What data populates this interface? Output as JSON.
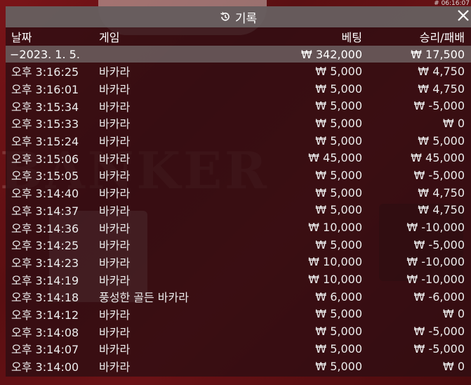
{
  "corner_time": "# 06:16:07",
  "header": {
    "title": "기록",
    "icon": "history-icon",
    "close_icon": "close-icon"
  },
  "columns": {
    "date": "날짜",
    "game": "게임",
    "bet": "베팅",
    "win_loss": "승리/패배"
  },
  "summary": {
    "date": "−2023. 1. 5.",
    "bet": "₩ 342,000",
    "win_loss": "₩ 17,500"
  },
  "rows": [
    {
      "time": "오후 3:16:25",
      "game": "바카라",
      "bet": "₩ 5,000",
      "result": "₩ 4,750"
    },
    {
      "time": "오후 3:16:01",
      "game": "바카라",
      "bet": "₩ 5,000",
      "result": "₩ 4,750"
    },
    {
      "time": "오후 3:15:34",
      "game": "바카라",
      "bet": "₩ 5,000",
      "result": "₩ -5,000"
    },
    {
      "time": "오후 3:15:33",
      "game": "바카라",
      "bet": "₩ 5,000",
      "result": "₩ 0"
    },
    {
      "time": "오후 3:15:24",
      "game": "바카라",
      "bet": "₩ 5,000",
      "result": "₩ 5,000"
    },
    {
      "time": "오후 3:15:06",
      "game": "바카라",
      "bet": "₩ 45,000",
      "result": "₩ 45,000"
    },
    {
      "time": "오후 3:15:05",
      "game": "바카라",
      "bet": "₩ 5,000",
      "result": "₩ -5,000"
    },
    {
      "time": "오후 3:14:40",
      "game": "바카라",
      "bet": "₩ 5,000",
      "result": "₩ 4,750"
    },
    {
      "time": "오후 3:14:37",
      "game": "바카라",
      "bet": "₩ 5,000",
      "result": "₩ 4,750"
    },
    {
      "time": "오후 3:14:36",
      "game": "바카라",
      "bet": "₩ 10,000",
      "result": "₩ -10,000"
    },
    {
      "time": "오후 3:14:25",
      "game": "바카라",
      "bet": "₩ 5,000",
      "result": "₩ -5,000"
    },
    {
      "time": "오후 3:14:23",
      "game": "바카라",
      "bet": "₩ 10,000",
      "result": "₩ -10,000"
    },
    {
      "time": "오후 3:14:19",
      "game": "바카라",
      "bet": "₩ 10,000",
      "result": "₩ -10,000"
    },
    {
      "time": "오후 3:14:18",
      "game": "풍성한 골든 바카라",
      "bet": "₩ 6,000",
      "result": "₩ -6,000"
    },
    {
      "time": "오후 3:14:12",
      "game": "바카라",
      "bet": "₩ 5,000",
      "result": "₩ 0"
    },
    {
      "time": "오후 3:14:08",
      "game": "바카라",
      "bet": "₩ 5,000",
      "result": "₩ -5,000"
    },
    {
      "time": "오후 3:14:07",
      "game": "바카라",
      "bet": "₩ 5,000",
      "result": "₩ -5,000"
    },
    {
      "time": "오후 3:14:00",
      "game": "바카라",
      "bet": "₩ 5,000",
      "result": "₩ 0"
    }
  ]
}
